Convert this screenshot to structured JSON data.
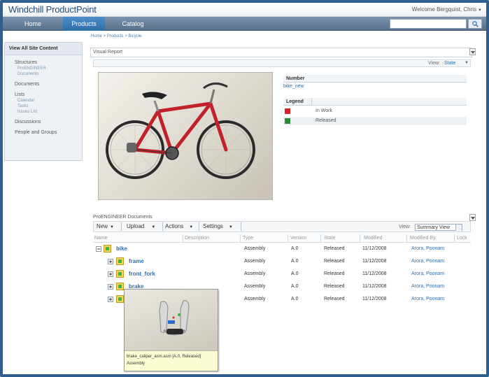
{
  "header": {
    "brand": "Windchill ProductPoint",
    "welcome": "Welcome Bergquist, Chris",
    "welcome_caret": "▼"
  },
  "nav": {
    "tabs": [
      {
        "label": "Home"
      },
      {
        "label": "Products"
      },
      {
        "label": "Catalog"
      }
    ],
    "active_tab": "Products",
    "search_placeholder": ""
  },
  "breadcrumb": "Home > Products > Bicycle",
  "sidebar": {
    "view_all": "View All Site Content",
    "structures": "Structures",
    "structures_sub": [
      "ProENGINEER",
      "Documents"
    ],
    "documents": "Documents",
    "lists": "Lists",
    "lists_sub": [
      "Calendar",
      "Tasks",
      "Issues List"
    ],
    "discussions": "Discussions",
    "people": "People and Groups"
  },
  "visual_report": {
    "title": "Visual Report",
    "view_label": "View:",
    "view_value": "State",
    "number_label": "Number",
    "number_value": "bike_new",
    "legend_label": "Legend",
    "legend": [
      {
        "label": "In Work",
        "color": "#d9232a"
      },
      {
        "label": "Released",
        "color": "#2a8a3a"
      }
    ]
  },
  "documents": {
    "title": "ProENGINEER Documents",
    "toolbar": {
      "new": "New",
      "upload": "Upload",
      "actions": "Actions",
      "settings": "Settings"
    },
    "view_label": "View:",
    "view_value": "Summary View",
    "columns": [
      "Name",
      "Description",
      "Type",
      "Version",
      "State",
      "Modified",
      "Modified By",
      "Lock"
    ],
    "rows": [
      {
        "name": "bike",
        "type": "Assembly",
        "version": "A.0",
        "state": "Released",
        "modified": "11/12/2008",
        "modified_by": "Arora, Poonam"
      },
      {
        "name": "frame",
        "type": "Assembly",
        "version": "A.0",
        "state": "Released",
        "modified": "11/12/2008",
        "modified_by": "Arora, Poonam"
      },
      {
        "name": "front_fork",
        "type": "Assembly",
        "version": "A.0",
        "state": "Released",
        "modified": "11/12/2008",
        "modified_by": "Arora, Poonam"
      },
      {
        "name": "brake",
        "type": "Assembly",
        "version": "A.0",
        "state": "Released",
        "modified": "11/12/2008",
        "modified_by": "Arora, Poonam"
      },
      {
        "name": "",
        "type": "Assembly",
        "version": "A.0",
        "state": "Released",
        "modified": "11/12/2008",
        "modified_by": "Arora, Poonam"
      }
    ]
  },
  "tooltip": {
    "line1": "brake_caliper_asm.asm [A.0, Released]",
    "line2": "Assembly"
  },
  "colors": {
    "accent": "#2f6ea8",
    "nav_bg": "#6b849f",
    "frame": "#2e5f8f"
  }
}
